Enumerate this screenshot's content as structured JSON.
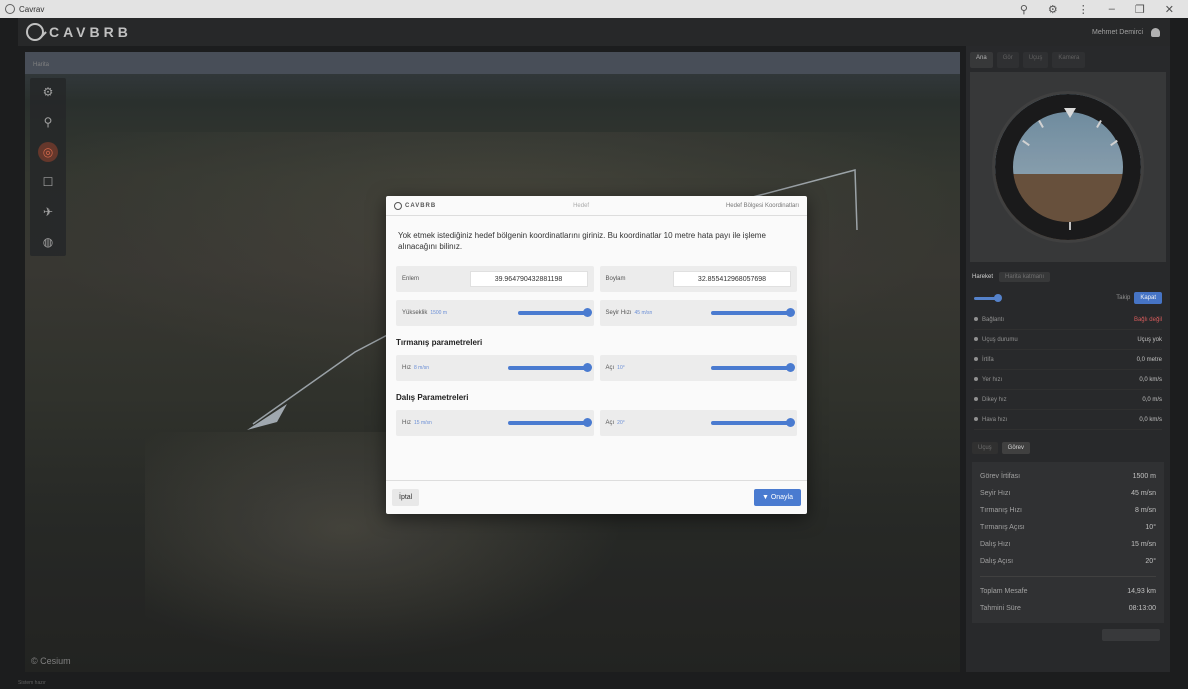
{
  "window": {
    "title": "Cavrav"
  },
  "brand": {
    "logo_text": "CAVBRB",
    "user_name": "Mehmet Demirci"
  },
  "map": {
    "watermark": "© Cesium",
    "corner_tag": "Harita"
  },
  "right_panel": {
    "tabs": [
      "Ana",
      "Gör",
      "Uçuş",
      "Kamera"
    ],
    "subtabs": {
      "active": "Hareket",
      "other": "Harita katmanı"
    },
    "follow_label": "Takip",
    "follow_button": "Kapat",
    "stats": [
      {
        "label": "Bağlantı",
        "value": "Bağlı değil",
        "red": true
      },
      {
        "label": "Uçuş durumu",
        "value": "Uçuş yok"
      },
      {
        "label": "İrtifa",
        "value": "0,0 metre"
      },
      {
        "label": "Yer hızı",
        "value": "0,0 km/s"
      },
      {
        "label": "Dikey hız",
        "value": "0,0 m/s"
      },
      {
        "label": "Hava hızı",
        "value": "0,0 km/s"
      }
    ],
    "tabs2": [
      "Uçuş",
      "Görev"
    ],
    "mission": [
      {
        "label": "Görev İrtifası",
        "value": "1500 m"
      },
      {
        "label": "Seyir Hızı",
        "value": "45 m/sn"
      },
      {
        "label": "Tırmanış Hızı",
        "value": "8 m/sn"
      },
      {
        "label": "Tırmanış Açısı",
        "value": "10°"
      },
      {
        "label": "Dalış Hızı",
        "value": "15 m/sn"
      },
      {
        "label": "Dalış Açısı",
        "value": "20°"
      }
    ],
    "mission2": [
      {
        "label": "Toplam Mesafe",
        "value": "14,93 km"
      },
      {
        "label": "Tahmini Süre",
        "value": "08:13:00"
      }
    ]
  },
  "status": "Sistem hazır",
  "modal": {
    "logo": "CAVBRB",
    "title": "Hedef",
    "right": "Hedef Bölgesi Koordinatları",
    "description": "Yok etmek istediğiniz hedef bölgenin koordinatlarını giriniz. Bu koordinatlar 10 metre hata payı ile işleme alınacağını bilinız.",
    "lat_label": "Enlem",
    "lat_value": "39.964790432881198",
    "lon_label": "Boylam",
    "lon_value": "32.855412968057698",
    "alt_label": "Yükseklik",
    "alt_unit": "1500 m",
    "speed_label": "Seyir Hızı",
    "speed_unit": "45 m/sn",
    "climb_title": "Tırmanış parametreleri",
    "climb_speed_label": "Hız",
    "climb_speed_unit": "8 m/sn",
    "climb_angle_label": "Açı",
    "climb_angle_unit": "10°",
    "dive_title": "Dalış Parametreleri",
    "dive_speed_label": "Hız",
    "dive_speed_unit": "15 m/sn",
    "dive_angle_label": "Açı",
    "dive_angle_unit": "20°",
    "cancel": "İptal",
    "confirm": "Onayla"
  },
  "colors": {
    "accent": "#4a7bd0",
    "active_tool": "#e07050"
  },
  "icons": [
    "gear-icon",
    "marker-icon",
    "target-icon",
    "square-icon",
    "plane-icon",
    "globe-icon"
  ]
}
